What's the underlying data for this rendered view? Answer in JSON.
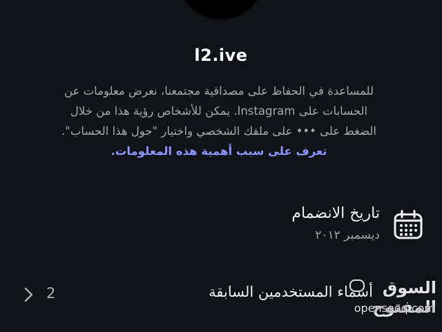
{
  "profile": {
    "username": "l2.ive"
  },
  "about": {
    "line1": "للمساعدة في الحفاظ على مصداقية مجتمعنا، نعرض معلومات عن",
    "line2": "الحسابات على Instagram. يمكن للأشخاص رؤية هذا من خلال",
    "line3": "الضغط على ••• على ملفك الشخصي واختيار \"حول هذا الحساب\".",
    "learn_more": "تعرف على سبب أهمية هذه المعلومات."
  },
  "date_joined": {
    "label": "تاريخ الانضمام",
    "value": "ديسمبر ٢٠١٢",
    "icon": "calendar-icon"
  },
  "former_usernames": {
    "label": "أسماء المستخدمين السابقة",
    "count": "2",
    "icon": "chevron-right-icon"
  },
  "watermark": {
    "arabic": "السوق المفتوح",
    "latin": "opensooq.com"
  },
  "colors": {
    "background": "#111318",
    "link": "#8c96ff",
    "secondary_text": "#a8a8a8"
  }
}
